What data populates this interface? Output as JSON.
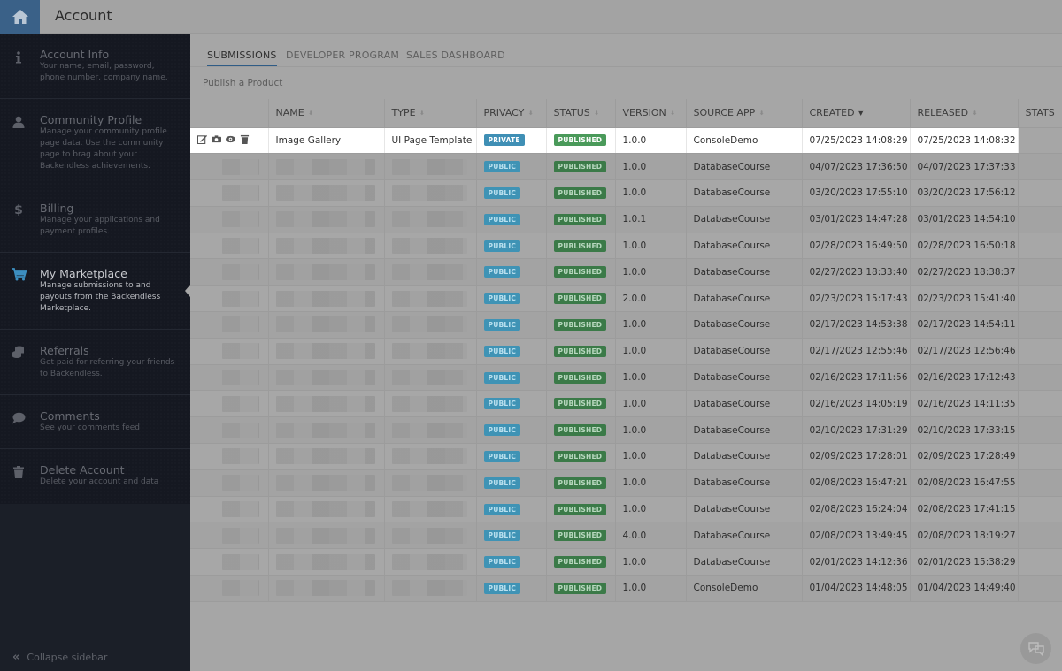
{
  "header": {
    "title": "Account",
    "home_icon": "home-icon"
  },
  "sidebar": {
    "items": [
      {
        "icon": "info-icon",
        "title": "Account Info",
        "desc": "Your name, email, password, phone number, company name.",
        "active": false
      },
      {
        "icon": "user-icon",
        "title": "Community Profile",
        "desc": "Manage your community profile page data. Use the community page to brag about your Backendless achievements.",
        "active": false
      },
      {
        "icon": "dollar-icon",
        "title": "Billing",
        "desc": "Manage your applications and payment profiles.",
        "active": false
      },
      {
        "icon": "cart-icon",
        "title": "My Marketplace",
        "desc": "Manage submissions to and payouts from the Backendless Marketplace.",
        "active": true
      },
      {
        "icon": "coins-icon",
        "title": "Referrals",
        "desc": "Get paid for referring your friends to Backendless.",
        "active": false
      },
      {
        "icon": "comment-icon",
        "title": "Comments",
        "desc": "See your comments feed",
        "active": false
      },
      {
        "icon": "trash-icon",
        "title": "Delete Account",
        "desc": "Delete your account and data",
        "active": false
      }
    ],
    "collapse_label": "Collapse sidebar"
  },
  "tabs": [
    {
      "label": "SUBMISSIONS",
      "active": true
    },
    {
      "label": "DEVELOPER PROGRAM",
      "active": false
    },
    {
      "label": "SALES DASHBOARD",
      "active": false
    }
  ],
  "publish_link": "Publish a Product",
  "table": {
    "columns": [
      "",
      "NAME",
      "TYPE",
      "PRIVACY",
      "STATUS",
      "VERSION",
      "SOURCE APP",
      "CREATED",
      "RELEASED",
      "STATS"
    ],
    "sorted_column": "CREATED",
    "rows": [
      {
        "name": "Image Gallery",
        "type": "UI Page Template",
        "privacy": "PRIVATE",
        "status": "PUBLISHED",
        "version": "1.0.0",
        "source_app": "ConsoleDemo",
        "created": "07/25/2023 14:08:29",
        "released": "07/25/2023 14:08:32",
        "highlight": true
      },
      {
        "name": "",
        "type": "",
        "privacy": "PUBLIC",
        "status": "PUBLISHED",
        "version": "1.0.0",
        "source_app": "DatabaseCourse",
        "created": "04/07/2023 17:36:50",
        "released": "04/07/2023 17:37:33"
      },
      {
        "name": "",
        "type": "",
        "privacy": "PUBLIC",
        "status": "PUBLISHED",
        "version": "1.0.0",
        "source_app": "DatabaseCourse",
        "created": "03/20/2023 17:55:10",
        "released": "03/20/2023 17:56:12"
      },
      {
        "name": "",
        "type": "",
        "privacy": "PUBLIC",
        "status": "PUBLISHED",
        "version": "1.0.1",
        "source_app": "DatabaseCourse",
        "created": "03/01/2023 14:47:28",
        "released": "03/01/2023 14:54:10"
      },
      {
        "name": "",
        "type": "",
        "privacy": "PUBLIC",
        "status": "PUBLISHED",
        "version": "1.0.0",
        "source_app": "DatabaseCourse",
        "created": "02/28/2023 16:49:50",
        "released": "02/28/2023 16:50:18"
      },
      {
        "name": "",
        "type": "",
        "privacy": "PUBLIC",
        "status": "PUBLISHED",
        "version": "1.0.0",
        "source_app": "DatabaseCourse",
        "created": "02/27/2023 18:33:40",
        "released": "02/27/2023 18:38:37"
      },
      {
        "name": "",
        "type": "",
        "privacy": "PUBLIC",
        "status": "PUBLISHED",
        "version": "2.0.0",
        "source_app": "DatabaseCourse",
        "created": "02/23/2023 15:17:43",
        "released": "02/23/2023 15:41:40"
      },
      {
        "name": "",
        "type": "",
        "privacy": "PUBLIC",
        "status": "PUBLISHED",
        "version": "1.0.0",
        "source_app": "DatabaseCourse",
        "created": "02/17/2023 14:53:38",
        "released": "02/17/2023 14:54:11"
      },
      {
        "name": "",
        "type": "",
        "privacy": "PUBLIC",
        "status": "PUBLISHED",
        "version": "1.0.0",
        "source_app": "DatabaseCourse",
        "created": "02/17/2023 12:55:46",
        "released": "02/17/2023 12:56:46"
      },
      {
        "name": "",
        "type": "",
        "privacy": "PUBLIC",
        "status": "PUBLISHED",
        "version": "1.0.0",
        "source_app": "DatabaseCourse",
        "created": "02/16/2023 17:11:56",
        "released": "02/16/2023 17:12:43"
      },
      {
        "name": "",
        "type": "",
        "privacy": "PUBLIC",
        "status": "PUBLISHED",
        "version": "1.0.0",
        "source_app": "DatabaseCourse",
        "created": "02/16/2023 14:05:19",
        "released": "02/16/2023 14:11:35"
      },
      {
        "name": "",
        "type": "",
        "privacy": "PUBLIC",
        "status": "PUBLISHED",
        "version": "1.0.0",
        "source_app": "DatabaseCourse",
        "created": "02/10/2023 17:31:29",
        "released": "02/10/2023 17:33:15"
      },
      {
        "name": "",
        "type": "",
        "privacy": "PUBLIC",
        "status": "PUBLISHED",
        "version": "1.0.0",
        "source_app": "DatabaseCourse",
        "created": "02/09/2023 17:28:01",
        "released": "02/09/2023 17:28:49"
      },
      {
        "name": "",
        "type": "",
        "privacy": "PUBLIC",
        "status": "PUBLISHED",
        "version": "1.0.0",
        "source_app": "DatabaseCourse",
        "created": "02/08/2023 16:47:21",
        "released": "02/08/2023 16:47:55"
      },
      {
        "name": "",
        "type": "",
        "privacy": "PUBLIC",
        "status": "PUBLISHED",
        "version": "1.0.0",
        "source_app": "DatabaseCourse",
        "created": "02/08/2023 16:24:04",
        "released": "02/08/2023 17:41:15"
      },
      {
        "name": "",
        "type": "",
        "privacy": "PUBLIC",
        "status": "PUBLISHED",
        "version": "4.0.0",
        "source_app": "DatabaseCourse",
        "created": "02/08/2023 13:49:45",
        "released": "02/08/2023 18:19:27"
      },
      {
        "name": "",
        "type": "",
        "privacy": "PUBLIC",
        "status": "PUBLISHED",
        "version": "1.0.0",
        "source_app": "DatabaseCourse",
        "created": "02/01/2023 14:12:36",
        "released": "02/01/2023 15:38:29"
      },
      {
        "name": "",
        "type": "",
        "privacy": "PUBLIC",
        "status": "PUBLISHED",
        "version": "1.0.0",
        "source_app": "ConsoleDemo",
        "created": "01/04/2023 14:48:05",
        "released": "01/04/2023 14:49:40"
      }
    ],
    "row_action_icons": [
      "edit-icon",
      "screenshots-icon",
      "preview-eye-icon",
      "delete-trash-icon"
    ]
  },
  "colors": {
    "accent": "#3a6188",
    "sidebar_bg": "#151821",
    "public_badge": "#3f93b5",
    "published_badge": "#3b7a48",
    "overlay": "#a6a6a6"
  },
  "chat_icon": "chat-bubbles-icon"
}
